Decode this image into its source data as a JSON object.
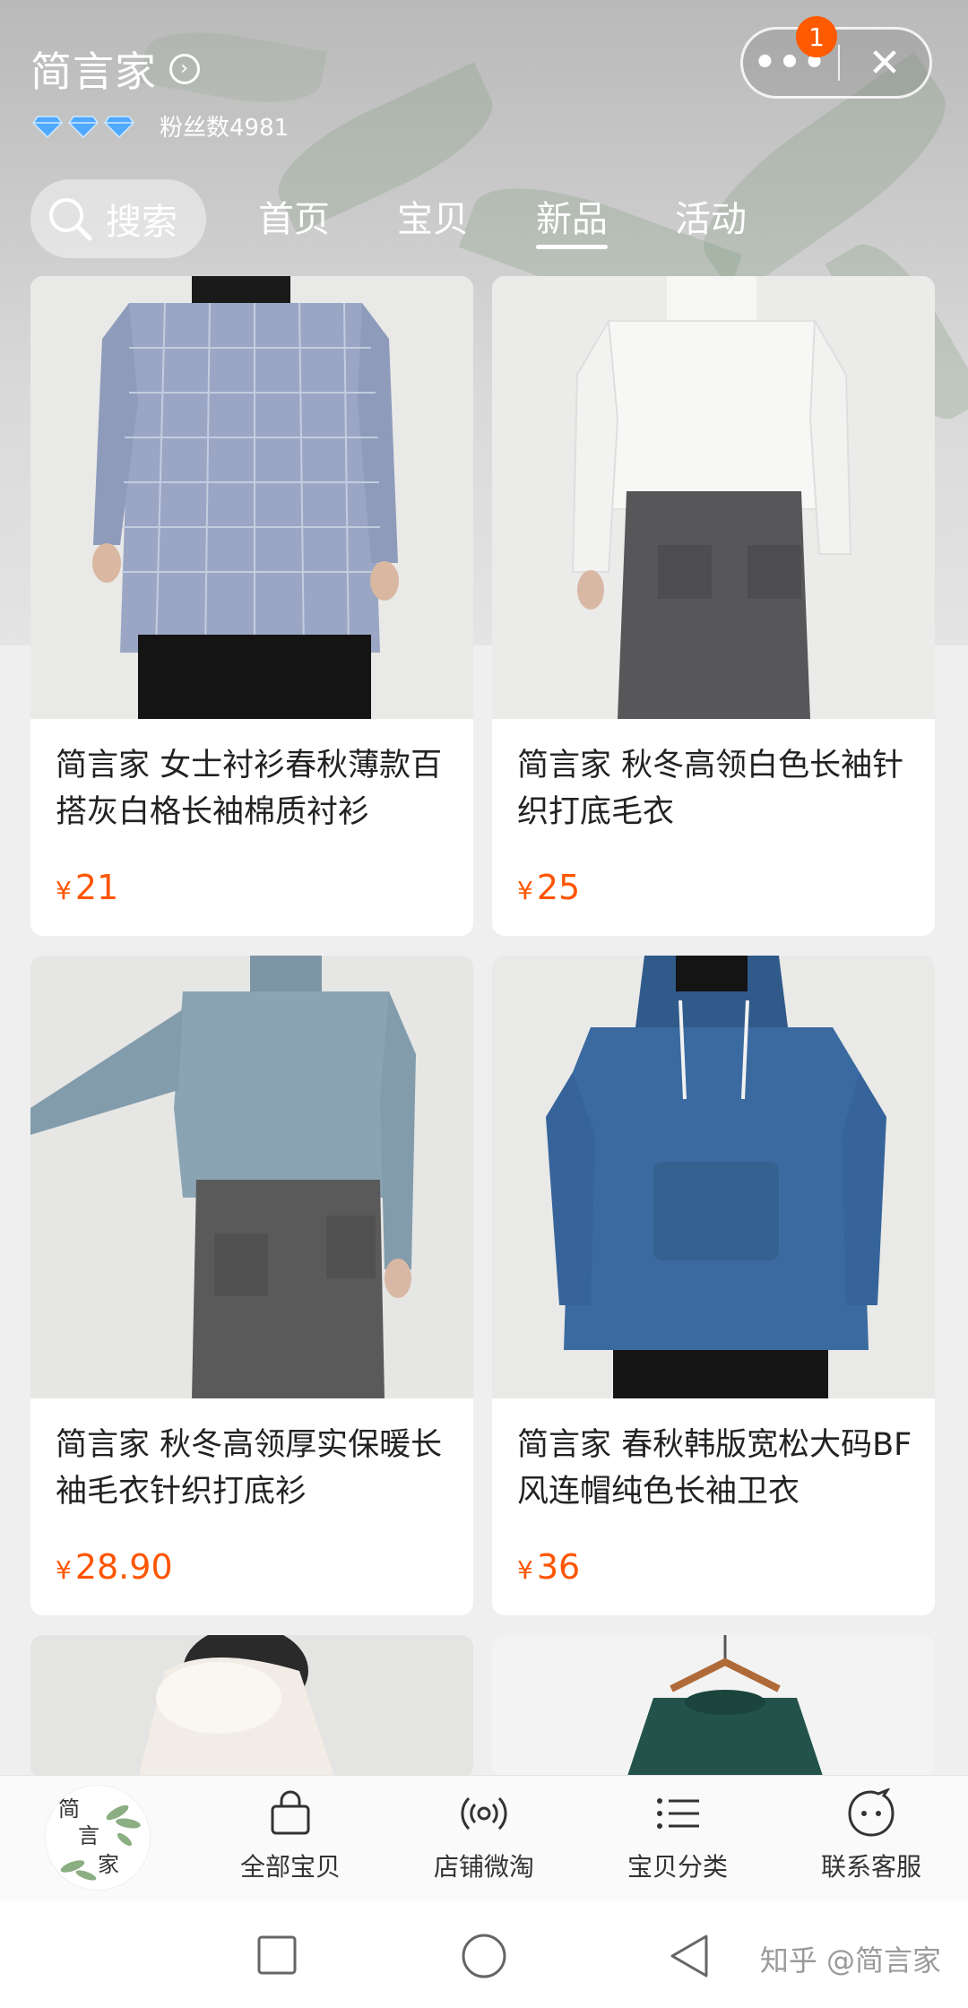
{
  "store": {
    "name": "简言家",
    "fans_label": "粉丝数4981",
    "diamond_count": 3
  },
  "capsule": {
    "badge_count": "1"
  },
  "nav": {
    "search_label": "搜索",
    "tabs": [
      "首页",
      "宝贝",
      "新品",
      "活动"
    ],
    "active_tab": "新品"
  },
  "products": [
    {
      "title": "简言家 女士衬衫春秋薄款百搭灰白格长袖棉质衬衫",
      "currency": "¥",
      "price": "21"
    },
    {
      "title": "简言家 秋冬高领白色长袖针织打底毛衣",
      "currency": "¥",
      "price": "25"
    },
    {
      "title": "简言家 秋冬高领厚实保暖长袖毛衣针织打底衫",
      "currency": "¥",
      "price": "28.90"
    },
    {
      "title": "简言家 春秋韩版宽松大码BF风连帽纯色长袖卫衣",
      "currency": "¥",
      "price": "36"
    }
  ],
  "toolbar": {
    "logo_text": "简言家",
    "items": [
      "全部宝贝",
      "店铺微淘",
      "宝贝分类",
      "联系客服"
    ]
  },
  "watermark": "知乎 @简言家",
  "colors": {
    "price": "#ff5500",
    "badge": "#ff5a00",
    "diamond": "#4fa9ff"
  }
}
